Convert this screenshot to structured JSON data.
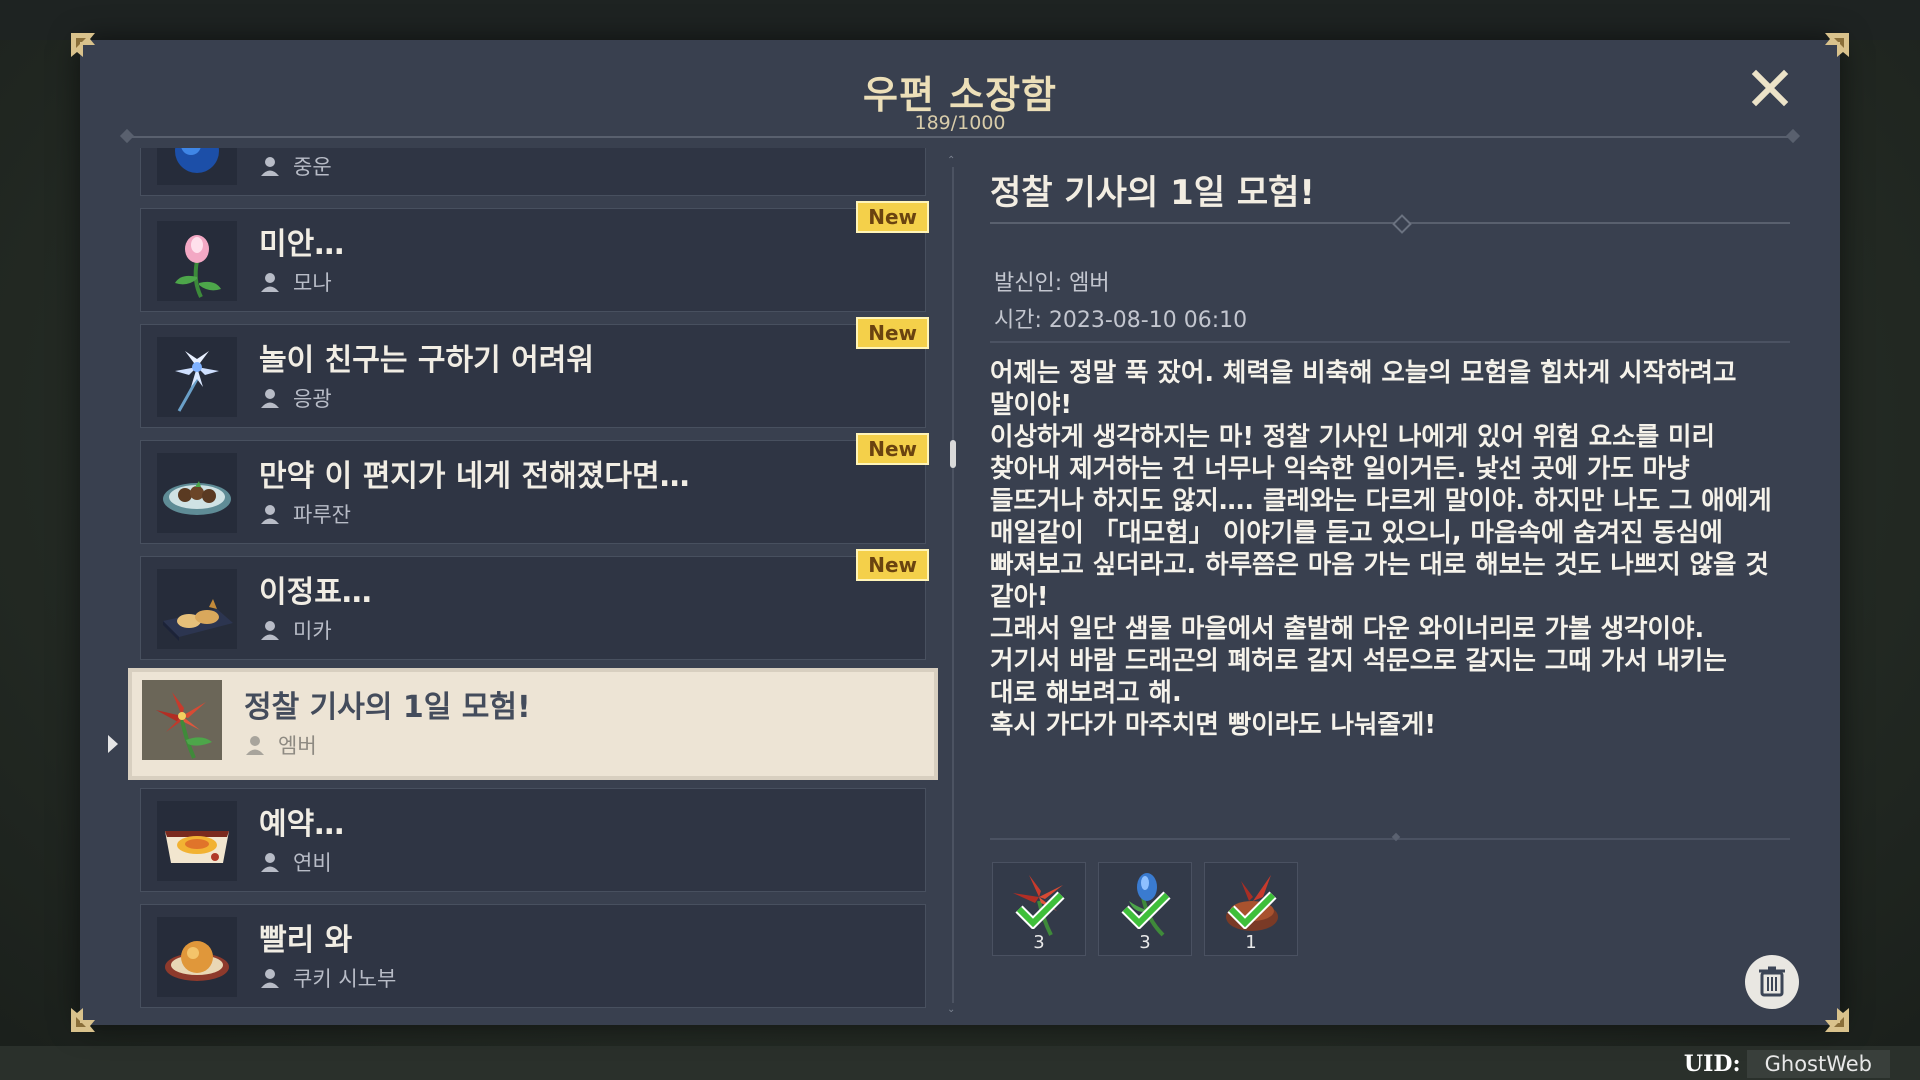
{
  "header": {
    "title": "우편 소장함",
    "count": "189/1000"
  },
  "mail_list": [
    {
      "title": "",
      "sender": "중운",
      "icon": "blue-orb-icon",
      "new": false,
      "new_label": ""
    },
    {
      "title": "미안…",
      "sender": "모나",
      "icon": "pink-flower-icon",
      "new": true,
      "new_label": "New"
    },
    {
      "title": "놀이 친구는 구하기 어려워",
      "sender": "응광",
      "icon": "glaze-lily-icon",
      "new": true,
      "new_label": "New"
    },
    {
      "title": "만약 이 편지가 네게 전해졌다면…",
      "sender": "파루잔",
      "icon": "dish-plate-icon",
      "new": true,
      "new_label": "New"
    },
    {
      "title": "이정표…",
      "sender": "미카",
      "icon": "pastry-tray-icon",
      "new": true,
      "new_label": "New"
    },
    {
      "title": "정찰 기사의 1일 모험!",
      "sender": "엠버",
      "icon": "red-flower-icon",
      "new": false,
      "new_label": "",
      "selected": true
    },
    {
      "title": "예약…",
      "sender": "연비",
      "icon": "omelette-box-icon",
      "new": false,
      "new_label": ""
    },
    {
      "title": "빨리 와",
      "sender": "쿠키 시노부",
      "icon": "fried-dish-icon",
      "new": false,
      "new_label": ""
    }
  ],
  "detail": {
    "title": "정찰 기사의 1일 모험!",
    "sender": "발신인: 엠버",
    "time": "시간: 2023-08-10 06:10",
    "body_lines": [
      "어제는 정말 푹 잤어. 체력을 비축해 오늘의 모험을 힘차게 시작하려고",
      "말이야!",
      "이상하게 생각하지는 마! 정찰 기사인 나에게 있어 위험 요소를 미리",
      "찾아내 제거하는 건 너무나 익숙한 일이거든. 낯선 곳에 가도 마냥",
      "들뜨거나 하지도 않지…. 클레와는 다르게 말이야. 하지만 나도 그 애에게",
      "매일같이 「대모험」 이야기를 듣고 있으니, 마음속에 숨겨진 동심에",
      "빠져보고 싶더라고. 하루쯤은 마음 가는 대로 해보는 것도 나쁘지 않을 것",
      "같아!",
      "그래서 일단 샘물 마을에서 출발해 다운 와이너리로 가볼 생각이야.",
      "거기서 바람 드래곤의 폐허로 갈지 석문으로 갈지는 그때 가서 내키는",
      "대로 해보려고 해.",
      "혹시 가다가 마주치면 빵이라도 나눠줄게!"
    ],
    "attachments": [
      {
        "icon": "red-flower-icon",
        "count": "3",
        "claimed": true
      },
      {
        "icon": "blue-bud-icon",
        "count": "3",
        "claimed": true
      },
      {
        "icon": "bird-nest-icon",
        "count": "1",
        "claimed": true
      }
    ]
  },
  "footer": {
    "uid_label": "UID:",
    "uid_value": "GhostWeb"
  },
  "colors": {
    "panel": "#39404f",
    "item_bg": "#2f3544",
    "selected_bg": "#ede4d5",
    "new_badge": "#f4d04a",
    "title_gold": "#ecdfb8"
  }
}
